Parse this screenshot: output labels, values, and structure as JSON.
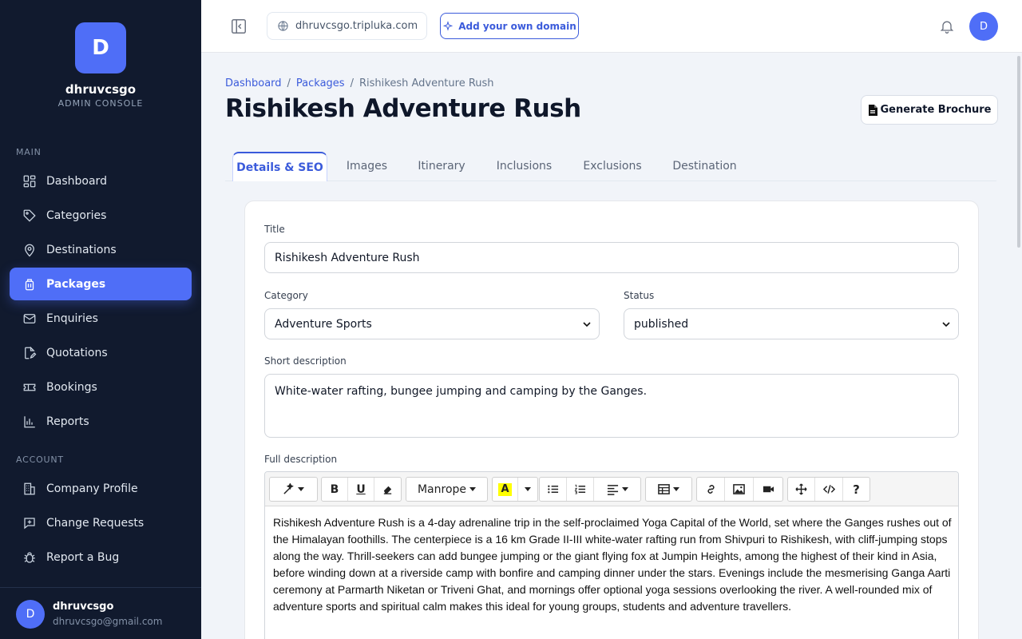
{
  "brand": {
    "initial": "D",
    "name": "dhruvcsgo",
    "subtitle": "ADMIN CONSOLE"
  },
  "sidebar": {
    "main_label": "MAIN",
    "main_items": [
      {
        "label": "Dashboard",
        "icon": "grid-icon"
      },
      {
        "label": "Categories",
        "icon": "tag-icon"
      },
      {
        "label": "Destinations",
        "icon": "map-pin-icon"
      },
      {
        "label": "Packages",
        "icon": "luggage-icon",
        "active": true
      },
      {
        "label": "Enquiries",
        "icon": "mail-icon"
      },
      {
        "label": "Quotations",
        "icon": "document-edit-icon"
      },
      {
        "label": "Bookings",
        "icon": "ticket-icon"
      },
      {
        "label": "Reports",
        "icon": "bar-chart-icon"
      }
    ],
    "account_label": "ACCOUNT",
    "account_items": [
      {
        "label": "Company Profile",
        "icon": "building-icon"
      },
      {
        "label": "Change Requests",
        "icon": "message-plus-icon"
      },
      {
        "label": "Report a Bug",
        "icon": "bug-icon"
      }
    ],
    "user": {
      "initial": "D",
      "name": "dhruvcsgo",
      "email": "dhruvcsgo@gmail.com"
    }
  },
  "topbar": {
    "domain": "dhruvcsgo.tripluka.com",
    "add_domain_label": "Add your own domain",
    "avatar_initial": "D"
  },
  "breadcrumb": {
    "home": "Dashboard",
    "section": "Packages",
    "current": "Rishikesh Adventure Rush",
    "separator": "/"
  },
  "page": {
    "title": "Rishikesh Adventure Rush",
    "generate_label": "Generate Brochure"
  },
  "tabs": [
    "Details & SEO",
    "Images",
    "Itinerary",
    "Inclusions",
    "Exclusions",
    "Destination"
  ],
  "form": {
    "title_label": "Title",
    "title_value": "Rishikesh Adventure Rush",
    "category_label": "Category",
    "category_value": "Adventure Sports",
    "status_label": "Status",
    "status_value": "published",
    "short_label": "Short description",
    "short_value": "White-water rafting, bungee jumping and camping by the Ganges.",
    "full_label": "Full description",
    "font_name": "Manrope",
    "full_value": "Rishikesh Adventure Rush is a 4-day adrenaline trip in the self-proclaimed Yoga Capital of the World, set where the Ganges rushes out of the Himalayan foothills. The centerpiece is a 16 km Grade II-III white-water rafting run from Shivpuri to Rishikesh, with cliff-jumping stops along the way. Thrill-seekers can add bungee jumping or the giant flying fox at Jumpin Heights, among the highest of their kind in Asia, before winding down at a riverside camp with bonfire and camping dinner under the stars. Evenings include the mesmerising Ganga Aarti ceremony at Parmarth Niketan or Triveni Ghat, and mornings offer optional yoga sessions overlooking the river. A well-rounded mix of adventure sports and spiritual calm makes this ideal for young groups, students and adventure travellers."
  },
  "colors": {
    "sidebar_bg": "#111a2e",
    "accent": "#4f6ef7",
    "link": "#3b5bdb"
  }
}
